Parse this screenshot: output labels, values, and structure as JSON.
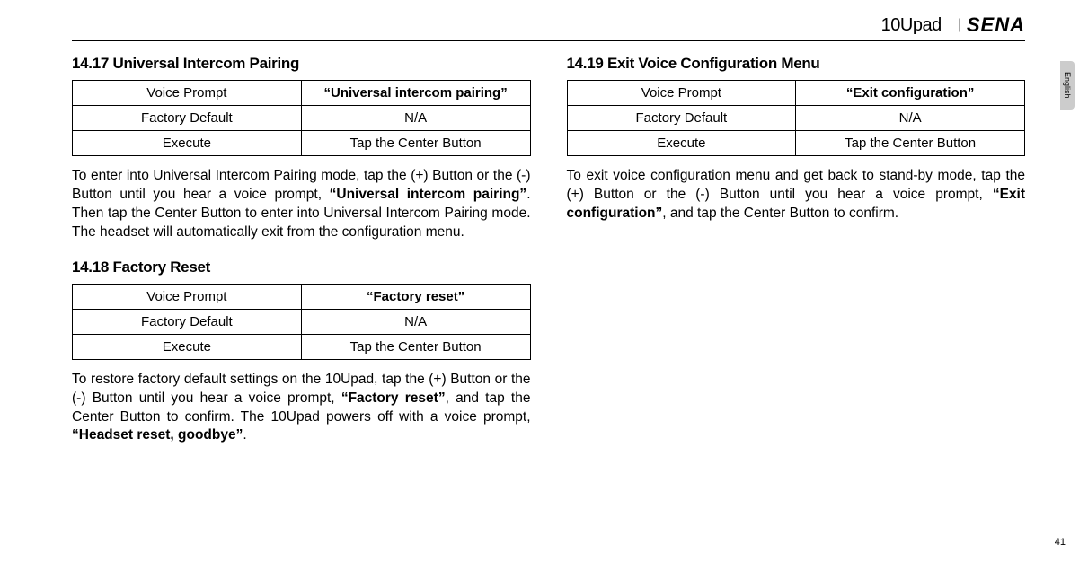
{
  "header": {
    "product": "10Upad",
    "brand": "SENA"
  },
  "sideTab": "English",
  "pageNumber": "41",
  "sections": {
    "s1": {
      "heading": "14.17 Universal Intercom Pairing",
      "table": {
        "r1c1": "Voice Prompt",
        "r1c2": "“Universal intercom pairing”",
        "r2c1": "Factory Default",
        "r2c2": "N/A",
        "r3c1": "Execute",
        "r3c2": "Tap the Center Button"
      },
      "para": {
        "t1": "To enter into Universal Intercom Pairing mode, tap the (+) Button or the (-) Button until you hear a voice prompt, ",
        "b1": "“Universal intercom pairing”",
        "t2": ". Then tap the Center Button to enter into Universal Intercom Pairing mode. The headset will automatically exit from the configuration menu."
      }
    },
    "s2": {
      "heading": "14.18 Factory Reset",
      "table": {
        "r1c1": "Voice Prompt",
        "r1c2": "“Factory reset”",
        "r2c1": "Factory Default",
        "r2c2": "N/A",
        "r3c1": "Execute",
        "r3c2": "Tap the Center Button"
      },
      "para": {
        "t1": "To restore factory default settings on the 10Upad, tap the (+) Button or the (-) Button until you hear a voice prompt, ",
        "b1": "“Factory reset”",
        "t2": ", and tap the Center Button to confirm. The 10Upad powers off with a voice prompt, ",
        "b2": "“Headset reset, goodbye”",
        "t3": "."
      }
    },
    "s3": {
      "heading": "14.19 Exit Voice Configuration Menu",
      "table": {
        "r1c1": "Voice Prompt",
        "r1c2": "“Exit configuration”",
        "r2c1": "Factory Default",
        "r2c2": "N/A",
        "r3c1": "Execute",
        "r3c2": "Tap the Center Button"
      },
      "para": {
        "t1": "To exit voice configuration menu and get back to stand-by mode, tap the (+) Button or the (-) Button until you hear a voice prompt, ",
        "b1": "“Exit configuration”",
        "t2": ", and tap the Center Button to confirm."
      }
    }
  }
}
